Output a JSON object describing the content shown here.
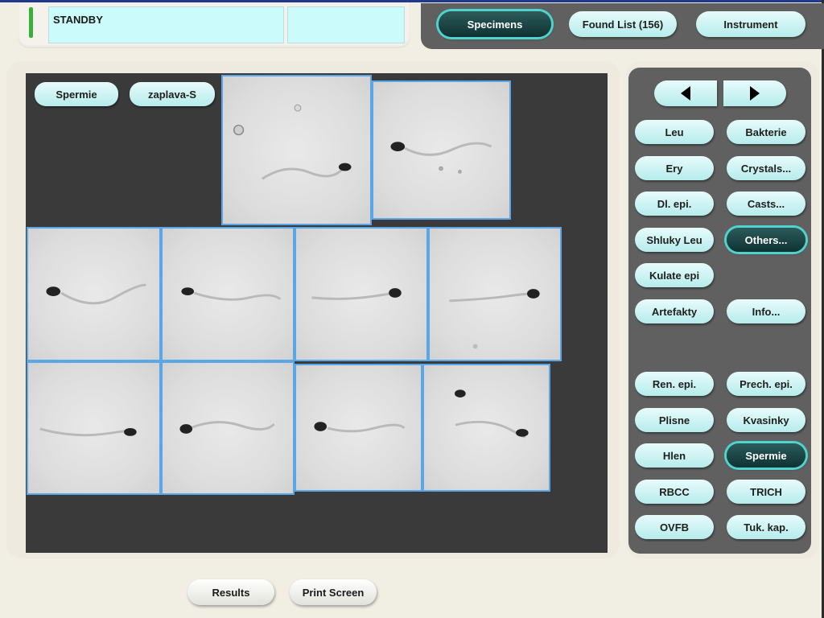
{
  "status": {
    "text": "STANDBY",
    "indicator_color": "#37b13a",
    "aux_text": ""
  },
  "modes": [
    {
      "label": "Specimens",
      "active": true
    },
    {
      "label": "Found List (156)",
      "active": false
    },
    {
      "label": "Instrument",
      "active": false
    }
  ],
  "image_tags": {
    "category": "Spermie",
    "specimen": "zaplava-S"
  },
  "navigation": {
    "prev_icon": "triangle-left-icon",
    "next_icon": "triangle-right-icon"
  },
  "classes": {
    "leu": "Leu",
    "bakterie": "Bakterie",
    "ery": "Ery",
    "crystals": "Crystals...",
    "dl_epi": "Dl. epi.",
    "casts": "Casts...",
    "shluky_leu": "Shluky Leu",
    "others": "Others...",
    "kulate_epi": "Kulate epi",
    "artefakty": "Artefakty",
    "info": "Info...",
    "ren_epi": "Ren. epi.",
    "prech_epi": "Prech. epi.",
    "plisne": "Plisne",
    "kvasinky": "Kvasinky",
    "hlen": "Hlen",
    "spermie": "Spermie",
    "rbcc": "RBCC",
    "trich": "TRICH",
    "ovfb": "OVFB",
    "tuk_kap": "Tuk. kap."
  },
  "active_classes": [
    "Others...",
    "Spermie"
  ],
  "colors": {
    "accent": "#4fd3cf",
    "button": "#c9f4f4",
    "active_button": "#0f3232",
    "panel": "#5f605f",
    "thumb_border": "#5aa6e6"
  },
  "bottom": {
    "results": "Results",
    "print_screen": "Print Screen"
  }
}
